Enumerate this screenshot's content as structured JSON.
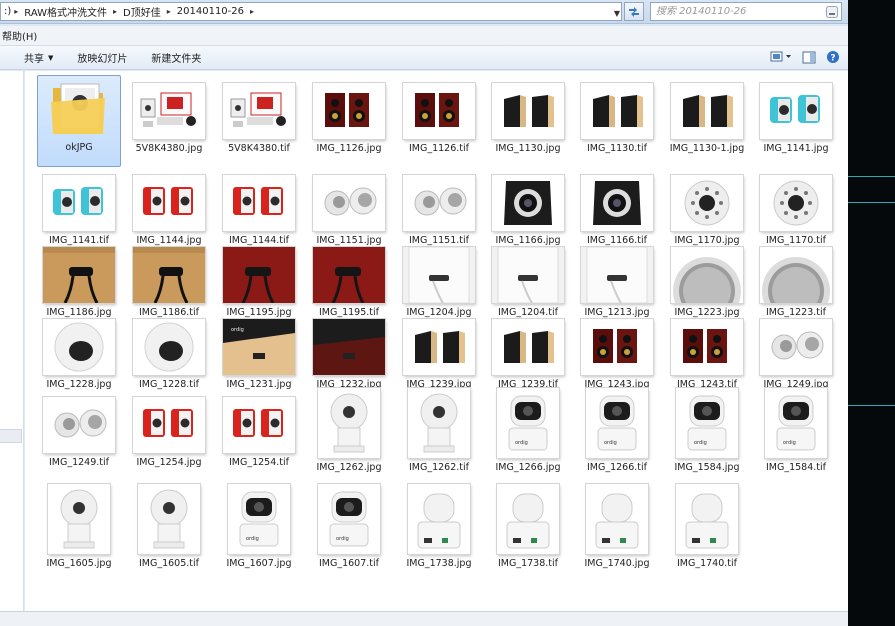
{
  "address": {
    "crumbs": [
      "RAW格式冲洗文件",
      "D顶好佳",
      "20140110-26"
    ],
    "prefix": ":)"
  },
  "search": {
    "placeholder": "搜索 20140110-26"
  },
  "menu": {
    "items": [
      "帮助(H)"
    ]
  },
  "toolbar": {
    "share": "共享",
    "slideshow": "放映幻灯片",
    "new_folder": "新建文件夹"
  },
  "colors": {
    "accent": "#3b78c4",
    "selection": "#cce4fc",
    "desktop_line": "#2aa7b3"
  },
  "files": [
    {
      "name": "okJPG",
      "kind": "folder"
    },
    {
      "name": "5V8K4380.jpg",
      "kind": "product-set"
    },
    {
      "name": "5V8K4380.tif",
      "kind": "product-set"
    },
    {
      "name": "IMG_1126.jpg",
      "kind": "red-speakers"
    },
    {
      "name": "IMG_1126.tif",
      "kind": "red-speakers"
    },
    {
      "name": "IMG_1130.jpg",
      "kind": "wood-speakers"
    },
    {
      "name": "IMG_1130.tif",
      "kind": "wood-speakers"
    },
    {
      "name": "IMG_1130-1.jpg",
      "kind": "wood-speakers"
    },
    {
      "name": "IMG_1141.jpg",
      "kind": "cyan-speakers"
    },
    {
      "name": "IMG_1141.tif",
      "kind": "cyan-speakers"
    },
    {
      "name": "IMG_1144.jpg",
      "kind": "red-mini-speakers"
    },
    {
      "name": "IMG_1144.tif",
      "kind": "red-mini-speakers"
    },
    {
      "name": "IMG_1151.jpg",
      "kind": "white-ball-pair"
    },
    {
      "name": "IMG_1151.tif",
      "kind": "white-ball-pair"
    },
    {
      "name": "IMG_1166.jpg",
      "kind": "camera-front"
    },
    {
      "name": "IMG_1166.tif",
      "kind": "camera-front"
    },
    {
      "name": "IMG_1170.jpg",
      "kind": "camera-leds"
    },
    {
      "name": "IMG_1170.tif",
      "kind": "camera-leds"
    },
    {
      "name": "IMG_1186.jpg",
      "kind": "wood-cable"
    },
    {
      "name": "IMG_1186.tif",
      "kind": "wood-cable"
    },
    {
      "name": "IMG_1195.jpg",
      "kind": "red-cable"
    },
    {
      "name": "IMG_1195.tif",
      "kind": "red-cable"
    },
    {
      "name": "IMG_1204.jpg",
      "kind": "white-port"
    },
    {
      "name": "IMG_1204.tif",
      "kind": "white-port"
    },
    {
      "name": "IMG_1213.jpg",
      "kind": "white-port"
    },
    {
      "name": "IMG_1223.jpg",
      "kind": "grille"
    },
    {
      "name": "IMG_1223.tif",
      "kind": "grille"
    },
    {
      "name": "IMG_1228.jpg",
      "kind": "white-sphere"
    },
    {
      "name": "IMG_1228.tif",
      "kind": "white-sphere"
    },
    {
      "name": "IMG_1231.jpg",
      "kind": "box-detail"
    },
    {
      "name": "IMG_1232.jpg",
      "kind": "box-detail-dark"
    },
    {
      "name": "IMG_1239.jpg",
      "kind": "wood-speakers"
    },
    {
      "name": "IMG_1239.tif",
      "kind": "wood-speakers"
    },
    {
      "name": "IMG_1243.jpg",
      "kind": "red-speakers"
    },
    {
      "name": "IMG_1243.tif",
      "kind": "red-speakers"
    },
    {
      "name": "IMG_1249.jpg",
      "kind": "white-ball-pair"
    },
    {
      "name": "IMG_1249.tif",
      "kind": "white-ball-pair"
    },
    {
      "name": "IMG_1254.jpg",
      "kind": "red-mini-speakers"
    },
    {
      "name": "IMG_1254.tif",
      "kind": "red-mini-speakers"
    },
    {
      "name": "IMG_1262.jpg",
      "kind": "camera-white-tall"
    },
    {
      "name": "IMG_1262.tif",
      "kind": "camera-white-tall"
    },
    {
      "name": "IMG_1266.jpg",
      "kind": "camera-black-tall"
    },
    {
      "name": "IMG_1266.tif",
      "kind": "camera-black-tall"
    },
    {
      "name": "IMG_1584.jpg",
      "kind": "camera-black-tall"
    },
    {
      "name": "IMG_1584.tif",
      "kind": "camera-black-tall"
    },
    {
      "name": "IMG_1605.jpg",
      "kind": "camera-white-tall"
    },
    {
      "name": "IMG_1605.tif",
      "kind": "camera-white-tall"
    },
    {
      "name": "IMG_1607.jpg",
      "kind": "camera-black-tall"
    },
    {
      "name": "IMG_1607.tif",
      "kind": "camera-black-tall"
    },
    {
      "name": "IMG_1738.jpg",
      "kind": "camera-back-tall"
    },
    {
      "name": "IMG_1738.tif",
      "kind": "camera-back-tall"
    },
    {
      "name": "IMG_1740.jpg",
      "kind": "camera-back-tall"
    },
    {
      "name": "IMG_1740.tif",
      "kind": "camera-back-tall"
    }
  ]
}
